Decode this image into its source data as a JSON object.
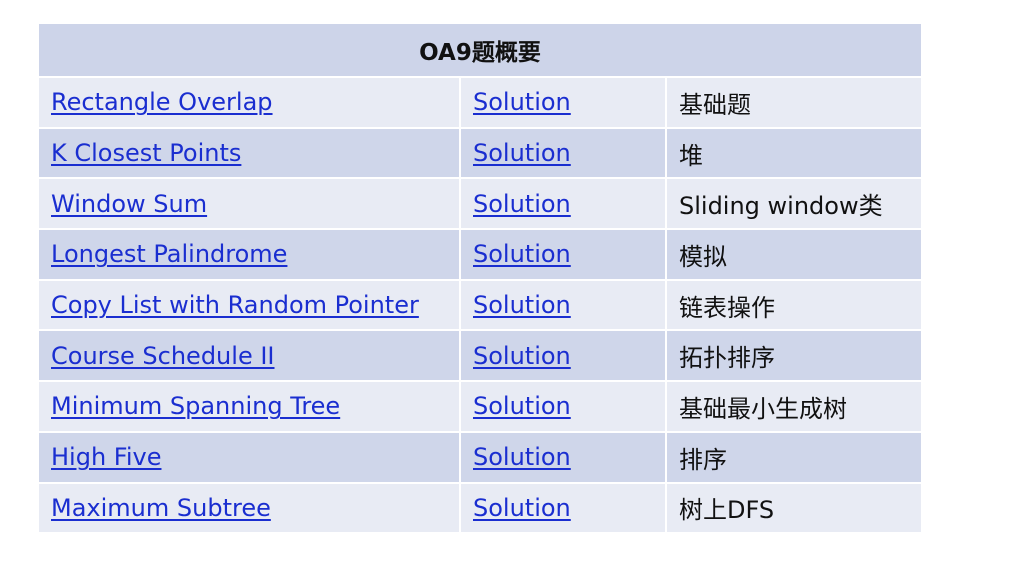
{
  "table": {
    "title": "OA9题概要",
    "rows": [
      {
        "problem": "Rectangle Overlap",
        "solution": "Solution",
        "note": "基础题"
      },
      {
        "problem": "K Closest Points",
        "solution": "Solution",
        "note": "堆"
      },
      {
        "problem": "Window Sum",
        "solution": "Solution",
        "note": "Sliding window类"
      },
      {
        "problem": "Longest Palindrome",
        "solution": "Solution",
        "note": "模拟"
      },
      {
        "problem": "Copy List with Random Pointer",
        "solution": "Solution",
        "note": "链表操作"
      },
      {
        "problem": "Course Schedule II",
        "solution": "Solution",
        "note": "拓扑排序"
      },
      {
        "problem": "Minimum Spanning Tree",
        "solution": "Solution",
        "note": "基础最小生成树"
      },
      {
        "problem": "High Five",
        "solution": "Solution",
        "note": "排序"
      },
      {
        "problem": "Maximum Subtree",
        "solution": "Solution",
        "note": "树上DFS"
      }
    ]
  },
  "colors": {
    "header_bg": "#cdd4e9",
    "row_light": "#e8ebf4",
    "row_dark": "#cfd6ea",
    "link": "#1a2ed0"
  }
}
